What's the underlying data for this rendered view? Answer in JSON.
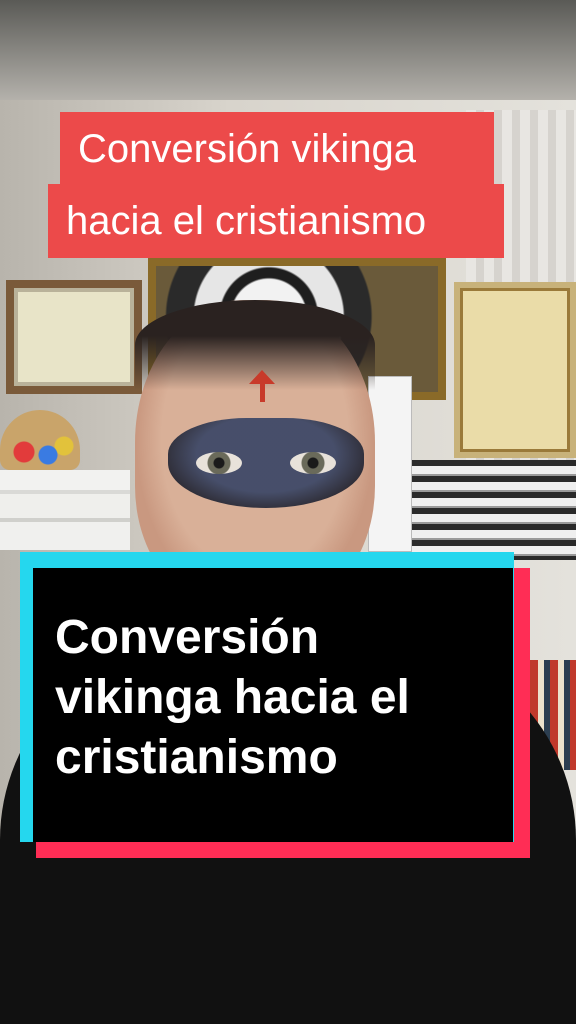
{
  "video": {
    "top_caption": {
      "line1": "Conversión vikinga",
      "line2": "hacia el cristianismo",
      "background_color": "#ec4a4a",
      "text_color": "#ffffff"
    },
    "title_card": {
      "line1": "Conversión",
      "line2": "vikinga hacia el",
      "line3": "cristianismo",
      "panel_color": "#000000",
      "accent_cyan": "#25d7ee",
      "accent_red": "#ff2d55"
    }
  }
}
